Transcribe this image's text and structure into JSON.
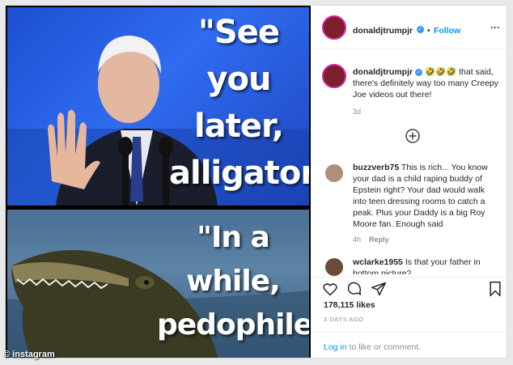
{
  "meme": {
    "top_text": "\"See you later, alligator!\"",
    "bottom_text": "\"In a while, pedophile!\"",
    "watermark": "© instagram"
  },
  "header": {
    "username": "donaldjtrumpjr",
    "follow_label": "Follow",
    "dot": "•",
    "more_icon": "ellipsis-icon"
  },
  "caption": {
    "username": "donaldjtrumpjr",
    "emojis": "🤣🤣🤣",
    "text": "that said, there's definitely way too many Creepy Joe videos out there!",
    "age": "3d"
  },
  "load_more_icon": "plus-circle-icon",
  "comments": [
    {
      "username": "buzzverb75",
      "text": "This is rich... You know your dad is a child raping buddy of Epstein right? Your dad would walk into teen dressing rooms to catch a peak. Plus your Daddy is a big Roy Moore fan. Enough said",
      "age": "4h",
      "reply_label": "Reply"
    },
    {
      "username": "wclarke1955",
      "text": "Is that your father in bottom picture?"
    }
  ],
  "actions": {
    "like_icon": "heart-icon",
    "comment_icon": "comment-icon",
    "share_icon": "share-icon",
    "save_icon": "bookmark-icon"
  },
  "likes": "178,115 likes",
  "date": "3 DAYS AGO",
  "login": {
    "link": "Log in",
    "text": " to like or comment."
  },
  "colors": {
    "accent": "#0095f6",
    "verified": "#3897f0",
    "meme_top_bg": "#2a5fe0",
    "meme_bottom_bg": "#4f7699"
  }
}
